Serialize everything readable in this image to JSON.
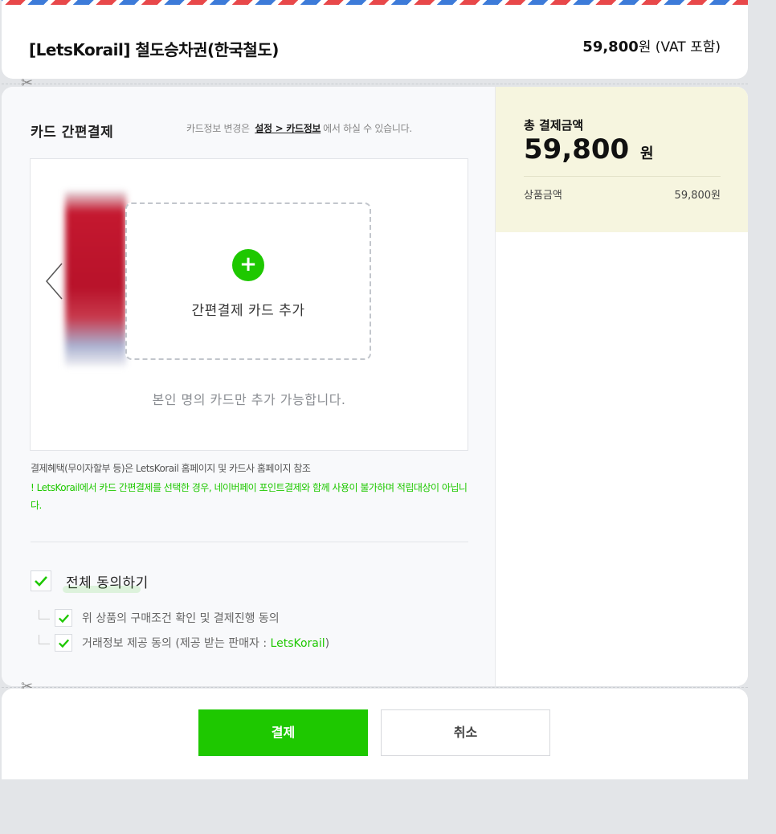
{
  "header": {
    "product_name": "[LetsKorail] 철도승차권(한국철도)",
    "price_value": "59,800",
    "price_suffix": "원 (VAT 포함)"
  },
  "icons": {
    "scissors": "✂",
    "prev": "chevron-left-icon",
    "plus": "+"
  },
  "card_section": {
    "title": "카드 간편결제",
    "info_before": "카드정보 변경은",
    "info_link": "설정 > 카드정보",
    "info_after": "에서 하실 수 있습니다.",
    "add_card_label": "간편결제 카드 추가",
    "own_card_notice": "본인 명의 카드만 추가 가능합니다.",
    "benefit_text": "결제혜택(무이자할부 등)은 LetsKorail 홈페이지 및 카드사 홈페이지 참조",
    "notice_text": "! LetsKorail에서 카드 간편결제를 선택한 경우, 네이버페이 포인트결제와 함께 사용이 불가하며 적립대상이 아닙니다."
  },
  "agreement": {
    "all_label": "전체 동의하기",
    "items": [
      {
        "label": "위 상품의 구매조건 확인 및 결제진행 동의",
        "suffix": ""
      },
      {
        "label": "거래정보 제공 동의 (제공 받는 판매자 : ",
        "seller": "LetsKorail",
        "suffix": ")"
      }
    ]
  },
  "summary": {
    "title": "총 결제금액",
    "amount": "59,800",
    "currency": "원",
    "item_label": "상품금액",
    "item_value": "59,800원"
  },
  "buttons": {
    "pay": "결제",
    "cancel": "취소"
  },
  "colors": {
    "accent": "#1ec800",
    "summary_bg": "#f6f5df"
  }
}
